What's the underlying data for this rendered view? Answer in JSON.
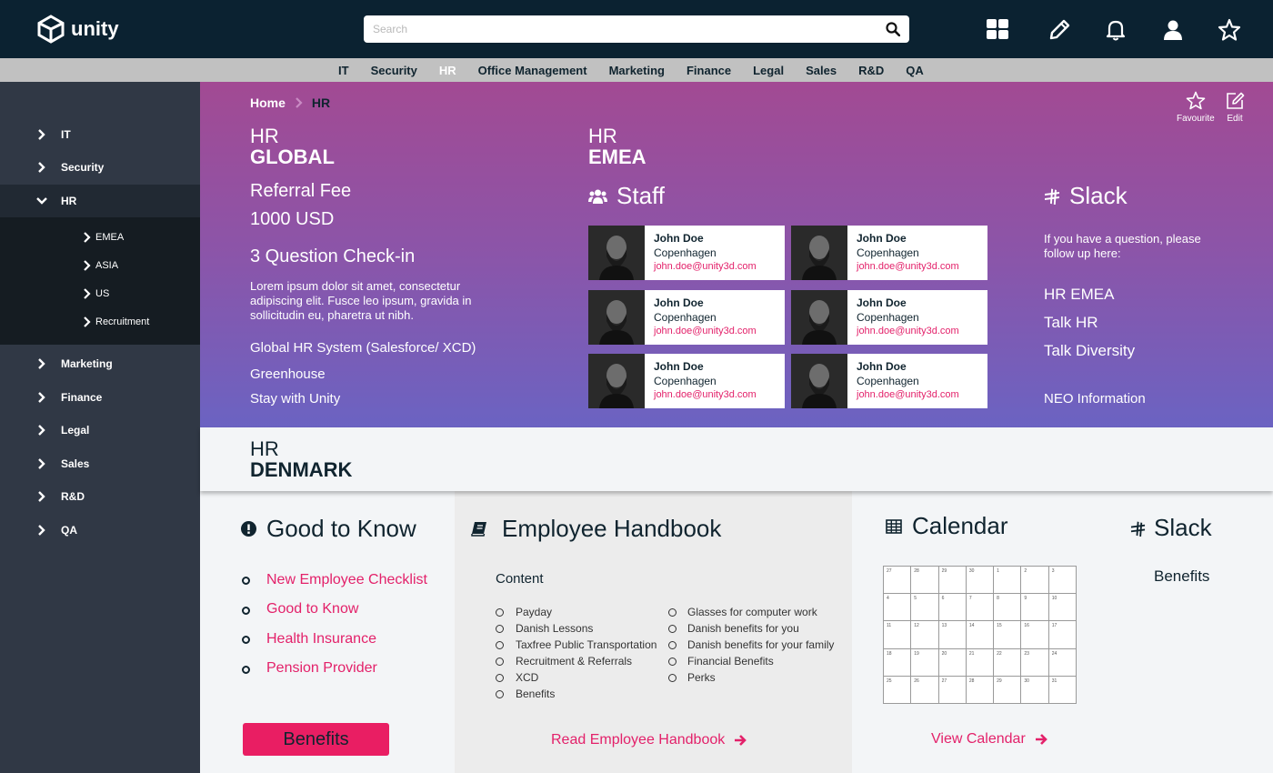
{
  "topbar": {
    "logo_text": "unity",
    "search_placeholder": "Search",
    "icons": [
      "apps-grid-icon",
      "pencil-icon",
      "bell-icon",
      "user-icon",
      "star-icon"
    ]
  },
  "dept_nav": {
    "items": [
      "IT",
      "Security",
      "HR",
      "Office Management",
      "Marketing",
      "Finance",
      "Legal",
      "Sales",
      "R&D",
      "QA"
    ],
    "active": "HR"
  },
  "sidebar": {
    "items": [
      "IT",
      "Security",
      "HR",
      "Marketing",
      "Finance",
      "Legal",
      "Sales",
      "R&D",
      "QA"
    ],
    "hr_subitems": [
      "EMEA",
      "ASIA",
      "US",
      "Recruitment"
    ]
  },
  "breadcrumb": {
    "home": "Home",
    "current": "HR"
  },
  "actions": {
    "favourite": "Favourite",
    "edit": "Edit"
  },
  "global": {
    "label_sub": "HR",
    "label_main": "GLOBAL",
    "referral_label": "Referral Fee",
    "referral_value": "1000 USD",
    "checkin_title": "3 Question Check-in",
    "checkin_text": "Lorem ipsum dolor sit amet, consectetur adipiscing elit. Fusce leo ipsum, gravida in sollicitudin eu, pharetra ut nibh.",
    "links": [
      "Global HR System (Salesforce/ XCD)",
      "Greenhouse",
      "Stay with Unity"
    ]
  },
  "emea": {
    "label_sub": "HR",
    "label_main": "EMEA",
    "staff_title": "Staff",
    "staff": [
      {
        "name": "John Doe",
        "city": "Copenhagen",
        "email": "john.doe@unity3d.com"
      },
      {
        "name": "John Doe",
        "city": "Copenhagen",
        "email": "john.doe@unity3d.com"
      },
      {
        "name": "John Doe",
        "city": "Copenhagen",
        "email": "john.doe@unity3d.com"
      },
      {
        "name": "John Doe",
        "city": "Copenhagen",
        "email": "john.doe@unity3d.com"
      },
      {
        "name": "John Doe",
        "city": "Copenhagen",
        "email": "john.doe@unity3d.com"
      },
      {
        "name": "John Doe",
        "city": "Copenhagen",
        "email": "john.doe@unity3d.com"
      }
    ]
  },
  "slack_hero": {
    "title": "Slack",
    "text": "If you have a question, please follow up here:",
    "channels": [
      "HR EMEA",
      "Talk HR",
      "Talk Diversity"
    ],
    "neo": "NEO Information"
  },
  "denmark": {
    "label_sub": "HR",
    "label_main": "DENMARK"
  },
  "good_to_know": {
    "title": "Good to Know",
    "links": [
      "New Employee Checklist",
      "Good to Know",
      "Health Insurance",
      "Pension Provider"
    ],
    "benefits_button": "Benefits"
  },
  "handbook": {
    "title": "Employee Handbook",
    "content_label": "Content",
    "col1": [
      "Payday",
      "Danish Lessons",
      "Taxfree Public Transportation",
      "Recruitment & Referrals",
      "XCD",
      "Benefits"
    ],
    "col2": [
      "Glasses for computer work",
      "Danish benefits for you",
      "Danish benefits for your family",
      "Financial Benefits",
      "Perks"
    ],
    "read_link": "Read Employee Handbook"
  },
  "calendar": {
    "title": "Calendar",
    "weeks": [
      [
        "27",
        "28",
        "29",
        "30",
        "1",
        "2",
        "3"
      ],
      [
        "4",
        "5",
        "6",
        "7",
        "8",
        "9",
        "10"
      ],
      [
        "11",
        "12",
        "13",
        "14",
        "15",
        "16",
        "17"
      ],
      [
        "18",
        "19",
        "20",
        "21",
        "22",
        "23",
        "24"
      ],
      [
        "25",
        "26",
        "27",
        "28",
        "29",
        "30",
        "31"
      ]
    ],
    "view_link": "View Calendar"
  },
  "slack_bottom": {
    "title": "Slack",
    "link": "Benefits"
  },
  "colors": {
    "accent_pink": "#e3216a",
    "topbar": "#0b2231",
    "sidebar": "#303845"
  }
}
